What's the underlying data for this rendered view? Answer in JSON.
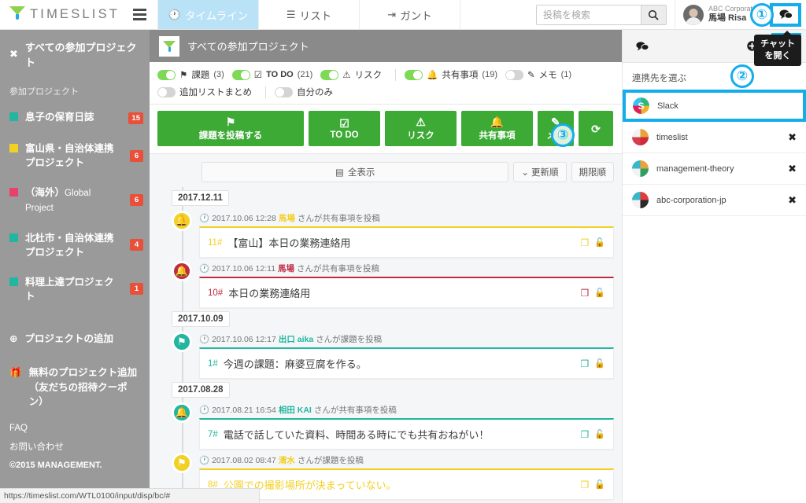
{
  "topbar": {
    "brand": "TIMESLIST",
    "menu_icon": "hamburger-icon",
    "tabs": [
      {
        "label": "タイムライン",
        "icon": "clock-icon",
        "active": true
      },
      {
        "label": "リスト",
        "icon": "list-icon",
        "active": false
      },
      {
        "label": "ガント",
        "icon": "gantt-icon",
        "active": false
      }
    ],
    "search": {
      "placeholder": "投稿を検索",
      "value": "",
      "button_icon": "search-icon"
    },
    "user": {
      "org": "ABC Corporation",
      "name": "馬場 Risa"
    },
    "chat_button_icon": "chat-bubble-icon"
  },
  "sidebar": {
    "header": "すべての参加プロジェクト",
    "header_icon": "projects-icon",
    "section_label": "参加プロジェクト",
    "projects": [
      {
        "name": "息子の保育日誌",
        "color": "#22b5a0",
        "badge": "15"
      },
      {
        "name": "富山県・自治体連携プロジェクト",
        "color": "#f2d024",
        "badge": "6"
      },
      {
        "name": "（海外）Global Project",
        "color": "#e8416a",
        "badge": "6",
        "latin": "Global Project",
        "jp": "（海外）"
      },
      {
        "name": "北杜市・自治体連携プロジェクト",
        "color": "#22b5a0",
        "badge": "4"
      },
      {
        "name": "料理上達プロジェクト",
        "color": "#22b5a0",
        "badge": "1"
      }
    ],
    "actions": [
      {
        "label": "プロジェクトの追加",
        "icon": "plus-circle-icon"
      },
      {
        "label": "無料のプロジェクト追加（友だちの招待クーポン）",
        "icon": "gift-icon"
      }
    ],
    "footer": {
      "faq": "FAQ",
      "contact": "お問い合わせ",
      "copyright": "©2015 MANAGEMENT."
    }
  },
  "main": {
    "project_title": "すべての参加プロジェクト",
    "project_icon": "funnel-icon",
    "filters": [
      {
        "label": "課題",
        "count": "(3)",
        "icon": "flag-icon",
        "on": true
      },
      {
        "label": "TO DO",
        "count": "(21)",
        "icon": "checkbox-icon",
        "on": true
      },
      {
        "label": "リスク",
        "count": "",
        "icon": "warning-icon",
        "on": true
      },
      {
        "label": "共有事項",
        "count": "(19)",
        "icon": "bell-icon",
        "on": true
      },
      {
        "label": "メモ",
        "count": "(1)",
        "icon": "memo-icon",
        "on": false
      }
    ],
    "filters_row2": [
      {
        "label": "追加リストまとめ",
        "on": false
      },
      {
        "label": "自分のみ",
        "on": false
      }
    ],
    "action_buttons": [
      {
        "label": "課題を投稿する",
        "icon": "flag-icon",
        "size": "wide"
      },
      {
        "label": "TO DO",
        "icon": "checkbox-icon",
        "size": "mid"
      },
      {
        "label": "リスク",
        "icon": "warning-icon",
        "size": "mid"
      },
      {
        "label": "共有事項",
        "icon": "bell-icon",
        "size": "mid"
      },
      {
        "label": "メモ",
        "icon": "memo-icon",
        "size": "sm"
      },
      {
        "label": "",
        "icon": "refresh-icon",
        "size": "xs"
      }
    ],
    "sortbar": {
      "all_label": "全表示",
      "all_icon": "window-icon",
      "update_order": "更新順",
      "update_icon": "chevron-down-icon",
      "deadline_order": "期限順"
    },
    "timeline": [
      {
        "date": "2017.12.11",
        "entries": [
          {
            "bullet_icon": "bell-icon",
            "bullet_color": "#f2d024",
            "timestamp": "2017.10.06 12:28",
            "author": "馬場",
            "meta_suffix": "さんが共有事項を投稿",
            "num": "11#",
            "title": "【富山】本日の業務連絡用",
            "accent": "#f2d024"
          },
          {
            "bullet_icon": "bell-icon",
            "bullet_color": "#c02a45",
            "timestamp": "2017.10.06 12:11",
            "author": "馬場",
            "meta_suffix": "さんが共有事項を投稿",
            "num": "10#",
            "title": "本日の業務連絡用",
            "accent": "#c02a45"
          }
        ]
      },
      {
        "date": "2017.10.09",
        "entries": [
          {
            "bullet_icon": "flag-icon",
            "bullet_color": "#22b5a0",
            "timestamp": "2017.10.06 12:17",
            "author": "出口 aika",
            "meta_suffix": "さんが課題を投稿",
            "num": "1#",
            "title": "今週の課題：麻婆豆腐を作る。",
            "accent": "#22b5a0"
          }
        ]
      },
      {
        "date": "2017.08.28",
        "entries": [
          {
            "bullet_icon": "bell-icon",
            "bullet_color": "#22b5a0",
            "timestamp": "2017.08.21 16:54",
            "author": "相田 KAI",
            "meta_suffix": "さんが共有事項を投稿",
            "num": "7#",
            "title": "電話で話していた資料、時間ある時にでも共有おねがい！",
            "accent": "#22b5a0"
          },
          {
            "bullet_icon": "flag-icon",
            "bullet_color": "#f2d024",
            "timestamp": "2017.08.02 08:47",
            "author": "清水",
            "meta_suffix": "さんが課題を投稿",
            "num": "8#",
            "title": "公園での撮影場所が決まっていない。",
            "accent": "#f2d024"
          }
        ]
      }
    ]
  },
  "right_panel": {
    "chat_icon": "chat-bubble-icon",
    "add_icon": "plus-circle-icon",
    "gear_icon": "gear-icon",
    "heading": "連携先を選ぶ",
    "items": [
      {
        "name": "Slack",
        "icon": "slack-icon",
        "highlight": true,
        "removable": false
      },
      {
        "name": "timeslist",
        "icon": "workspace-icon",
        "highlight": false,
        "removable": true,
        "remove_icon": "close-icon"
      },
      {
        "name": "management-theory",
        "icon": "workspace-icon",
        "highlight": false,
        "removable": true,
        "remove_icon": "close-icon"
      },
      {
        "name": "abc-corporation-jp",
        "icon": "workspace-icon",
        "highlight": false,
        "removable": true,
        "remove_icon": "close-icon"
      }
    ]
  },
  "overlays": {
    "tooltip": "チャット\nを開く",
    "tooltip_line1": "チャット",
    "tooltip_line2": "を開く",
    "markers": [
      {
        "label": "①"
      },
      {
        "label": "②"
      },
      {
        "label": "③"
      }
    ],
    "accent_color": "#13adeb"
  },
  "statusbar": {
    "url": "https://timeslist.com/WTL0100/input/disp/bc/#"
  }
}
